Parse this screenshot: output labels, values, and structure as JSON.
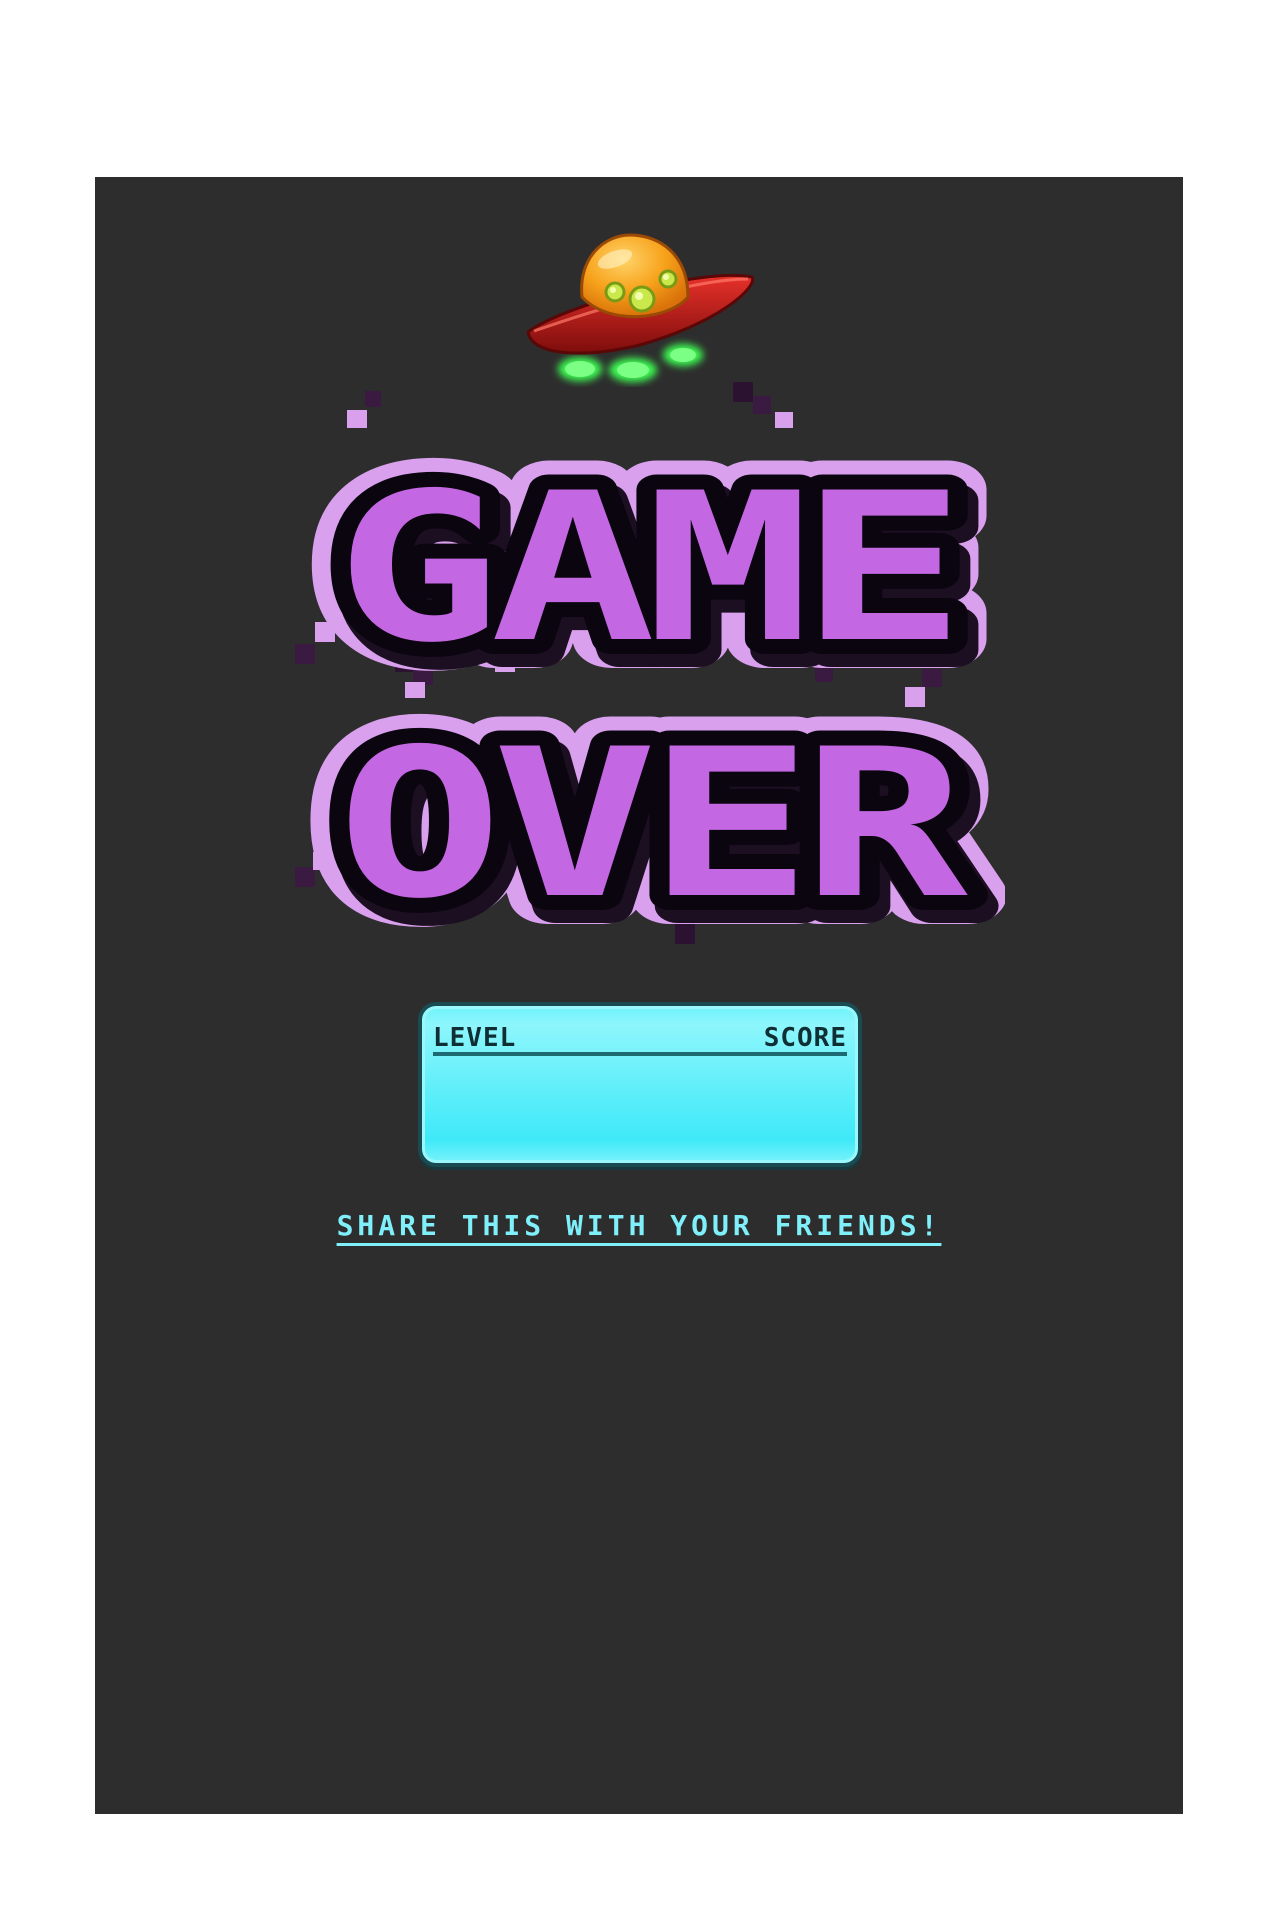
{
  "title": {
    "line1": "GAME",
    "line2": "OVER"
  },
  "score_panel": {
    "level_label": "LEVEL",
    "score_label": "SCORE"
  },
  "share": {
    "label": "SHARE THIS WITH YOUR FRIENDS!"
  },
  "colors": {
    "background": "#2d2d2d",
    "page": "#ffffff",
    "title_fill": "#c467e2",
    "title_outline": "#d9a0ee",
    "title_shadow": "#1c0f22",
    "panel": "#4ff0fb",
    "link": "#7ff0fa"
  },
  "icons": {
    "mascot": "ufo-icon"
  }
}
